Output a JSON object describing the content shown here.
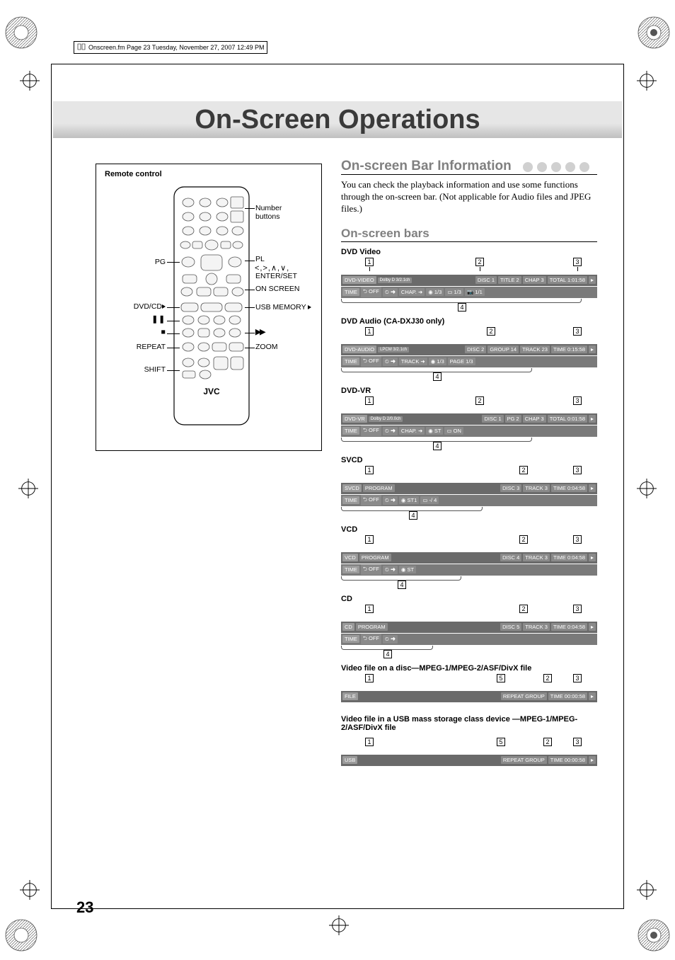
{
  "header_info": "Onscreen.fm  Page 23  Tuesday, November 27, 2007  12:49 PM",
  "main_title": "On-Screen Operations",
  "remote": {
    "box_title": "Remote control",
    "brand": "JVC",
    "labels_left": {
      "pg": "PG",
      "dvdcd": "DVD/CD",
      "pause": "",
      "stop": "",
      "repeat": "REPEAT",
      "shift": "SHIFT"
    },
    "labels_right": {
      "number": "Number buttons",
      "pl": "PL",
      "arrows": "",
      "enterset": "ENTER/SET",
      "onscreen": "ON SCREEN",
      "usb": "USB MEMORY",
      "ff": "",
      "zoom": "ZOOM"
    }
  },
  "section_title": "On-screen Bar Information",
  "body_text": "You can check the playback information and use some functions through the on-screen bar. (Not applicable for Audio files and JPEG files.)",
  "subhead": "On-screen bars",
  "bars": {
    "dvd_video": {
      "label": "DVD Video",
      "nums_top": [
        "1",
        "2",
        "3"
      ],
      "row1": {
        "type": "DVD-VIDEO",
        "audio": "Dolby D 3/2.1ch",
        "cells": [
          "DISC 1",
          "TITLE  2",
          "CHAP  3",
          "TOTAL  1:01:58"
        ]
      },
      "row2": {
        "pre": "TIME",
        "mode": "OFF",
        "cells": [
          "CHAP.",
          "1/3",
          "1/3",
          "1/1"
        ]
      },
      "num_bottom": "4"
    },
    "dvd_audio": {
      "label": "DVD Audio (CA-DXJ30 only)",
      "nums_top": [
        "1",
        "2",
        "3"
      ],
      "row1": {
        "type": "DVD-AUDIO",
        "audio": "LPCM 3/2.1ch",
        "cells": [
          "DISC 2",
          "GROUP  14",
          "TRACK  23",
          "TIME   0:15:58"
        ]
      },
      "row2": {
        "pre": "TIME",
        "mode": "OFF",
        "cells": [
          "TRACK",
          "1/3",
          "PAGE   1/3"
        ]
      },
      "num_bottom": "4"
    },
    "dvd_vr": {
      "label": "DVD-VR",
      "nums_top": [
        "1",
        "2",
        "3"
      ],
      "row1": {
        "type": "DVD-VR",
        "audio": "Dolby D 2/0.0ch",
        "cells": [
          "DISC 1",
          "PG     2",
          "CHAP   3",
          "TOTAL  0:01:58"
        ]
      },
      "row2": {
        "pre": "TIME",
        "mode": "OFF",
        "cells": [
          "CHAP.",
          "ST",
          "ON"
        ]
      },
      "num_bottom": "4"
    },
    "svcd": {
      "label": "SVCD",
      "nums_top": [
        "1",
        "2",
        "3"
      ],
      "row1": {
        "type": "SVCD",
        "audio": "PROGRAM",
        "cells": [
          "DISC 3",
          "TRACK  3",
          "TIME   0:04:58"
        ]
      },
      "row2": {
        "pre": "TIME",
        "mode": "OFF",
        "cells": [
          "ST1",
          "-/ 4"
        ]
      },
      "num_bottom": "4"
    },
    "vcd": {
      "label": "VCD",
      "nums_top": [
        "1",
        "2",
        "3"
      ],
      "row1": {
        "type": "VCD",
        "audio": "PROGRAM",
        "cells": [
          "DISC 4",
          "TRACK  3",
          "TIME   0:04:58"
        ]
      },
      "row2": {
        "pre": "TIME",
        "mode": "OFF",
        "cells": [
          "ST"
        ]
      },
      "num_bottom": "4"
    },
    "cd": {
      "label": "CD",
      "nums_top": [
        "1",
        "2",
        "3"
      ],
      "row1": {
        "type": "CD",
        "audio": "PROGRAM",
        "cells": [
          "DISC 5",
          "TRACK  3",
          "TIME   0:04:58"
        ]
      },
      "row2": {
        "pre": "TIME",
        "mode": "OFF",
        "cells": []
      },
      "num_bottom": "4"
    },
    "file_disc": {
      "label": "Video file on a disc—MPEG-1/MPEG-2/ASF/DivX file",
      "nums_top": [
        "1",
        "5",
        "2",
        "3"
      ],
      "row1": {
        "type": "FILE",
        "cells": [
          "REPEAT GROUP",
          "TIME  00:00:58"
        ]
      }
    },
    "file_usb": {
      "label": "Video file in a USB mass storage class device —MPEG-1/MPEG-2/ASF/DivX file",
      "nums_top": [
        "1",
        "5",
        "2",
        "3"
      ],
      "row1": {
        "type": "USB",
        "cells": [
          "REPEAT GROUP",
          "TIME  00:00:58"
        ]
      }
    }
  },
  "page_number": "23"
}
